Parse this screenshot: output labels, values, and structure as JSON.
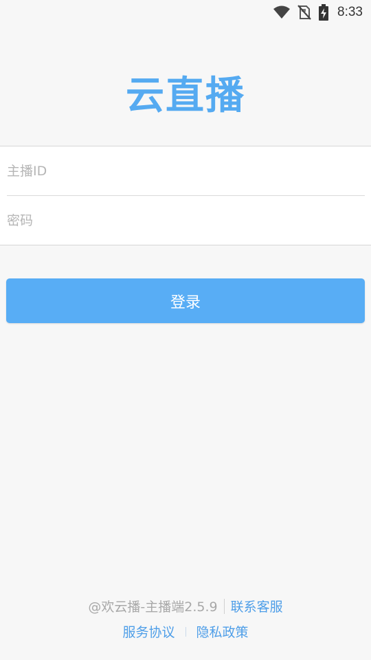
{
  "status_bar": {
    "time": "8:33",
    "icons": [
      "wifi-icon",
      "no-sim-icon",
      "battery-charging-icon"
    ]
  },
  "app": {
    "title": "云直播"
  },
  "form": {
    "anchor_id_placeholder": "主播ID",
    "password_placeholder": "密码",
    "anchor_id_value": "",
    "password_value": ""
  },
  "login_button": {
    "label": "登录"
  },
  "footer": {
    "version_text": "@欢云播-主播端2.5.9",
    "contact_link": "联系客服",
    "service_agreement_link": "服务协议",
    "privacy_policy_link": "隐私政策"
  },
  "colors": {
    "accent": "#55aaf1",
    "button": "#58adf5",
    "link": "#4e9ee8",
    "background": "#f7f7f7"
  }
}
